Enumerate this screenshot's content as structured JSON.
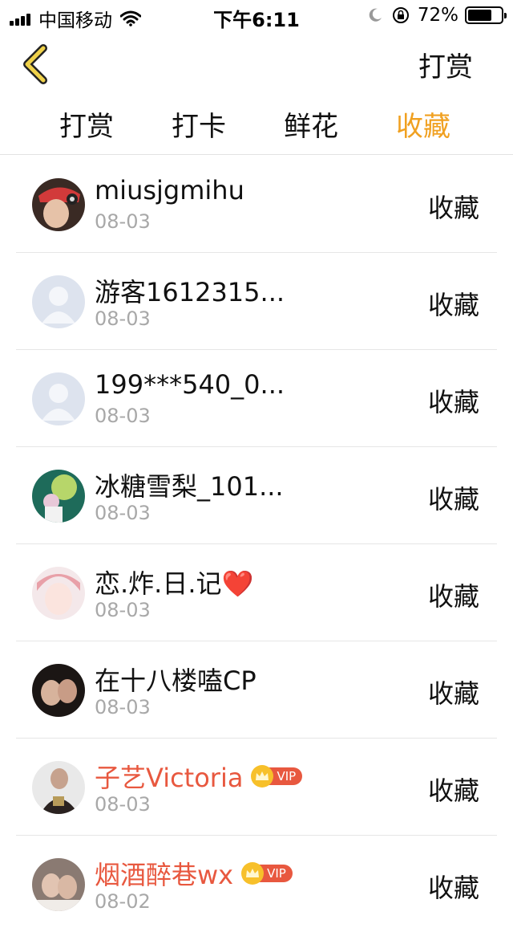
{
  "status_bar": {
    "carrier": "中国移动",
    "time": "下午6:11",
    "battery_percent": "72%",
    "battery_level": 0.72,
    "icons": [
      "signal-icon",
      "wifi-icon",
      "moon-icon",
      "rotation-lock-icon",
      "battery-icon"
    ]
  },
  "nav": {
    "back_icon": "chevron-left-icon",
    "action_label": "打赏"
  },
  "tabs": [
    {
      "label": "打赏",
      "active": false
    },
    {
      "label": "打卡",
      "active": false
    },
    {
      "label": "鲜花",
      "active": false
    },
    {
      "label": "收藏",
      "active": true
    }
  ],
  "accent_color": "#f0a020",
  "vip_name_color": "#e8583f",
  "list": [
    {
      "name": "miusjgmihu",
      "date": "08-03",
      "action": "收藏",
      "vip": false,
      "avatar": "photo"
    },
    {
      "name": "游客1612315...",
      "date": "08-03",
      "action": "收藏",
      "vip": false,
      "avatar": "default"
    },
    {
      "name": "199***540_0...",
      "date": "08-03",
      "action": "收藏",
      "vip": false,
      "avatar": "default"
    },
    {
      "name": "冰糖雪梨_101...",
      "date": "08-03",
      "action": "收藏",
      "vip": false,
      "avatar": "photo"
    },
    {
      "name": "恋.炸.日.记❤️",
      "date": "08-03",
      "action": "收藏",
      "vip": false,
      "avatar": "photo"
    },
    {
      "name": "在十八楼嗑CP",
      "date": "08-03",
      "action": "收藏",
      "vip": false,
      "avatar": "photo"
    },
    {
      "name": "子艺Victoria",
      "date": "08-03",
      "action": "收藏",
      "vip": true,
      "vip_label": "VIP",
      "avatar": "photo"
    },
    {
      "name": "烟酒醉巷wx",
      "date": "08-02",
      "action": "收藏",
      "vip": true,
      "vip_label": "VIP",
      "avatar": "photo"
    }
  ]
}
